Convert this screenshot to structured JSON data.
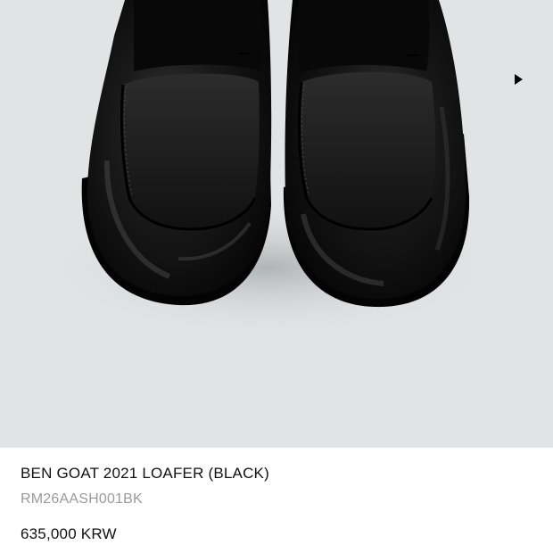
{
  "product": {
    "name": "BEN GOAT 2021 LOAFER (BLACK)",
    "sku": "RM26AASH001BK",
    "price": "635,000 KRW"
  },
  "gallery": {
    "next_icon": "play-triangle-icon",
    "background_color": "#e1e4e4"
  },
  "colors": {
    "title": "#111111",
    "sku": "#9a9a9a",
    "leather": "#0c0c0c"
  }
}
